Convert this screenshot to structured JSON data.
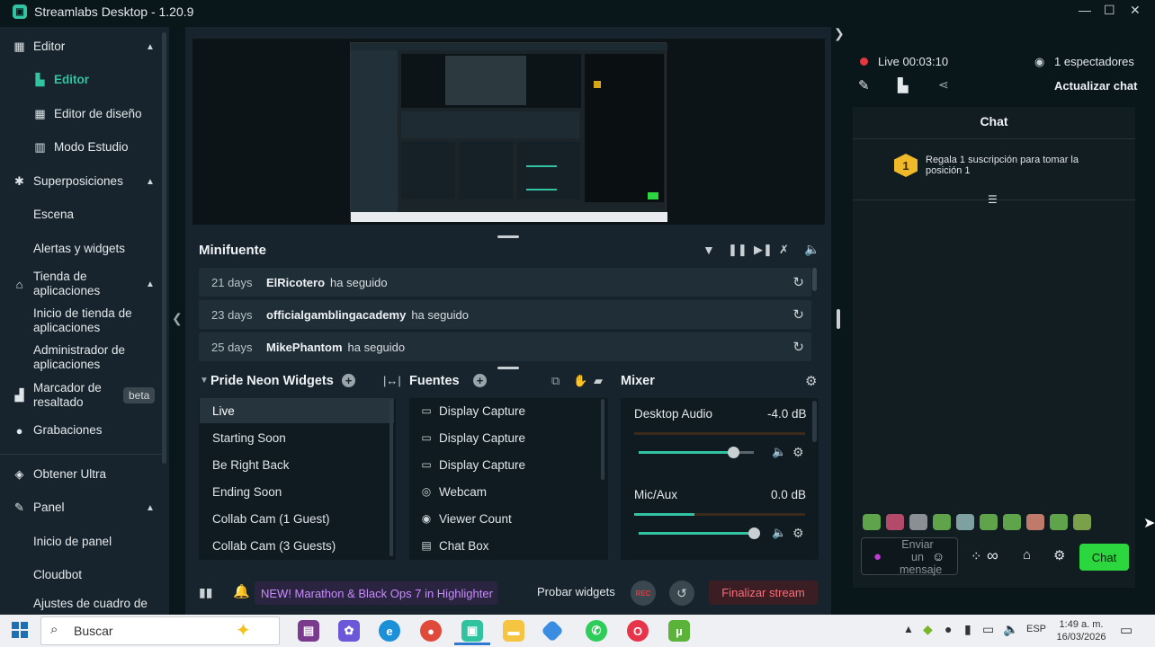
{
  "window": {
    "title": "Streamlabs Desktop - 1.20.9"
  },
  "sidebar": {
    "editor_group": "Editor",
    "editor": "Editor",
    "layout_editor": "Editor de diseño",
    "studio_mode": "Modo Estudio",
    "overlays_group": "Superposiciones",
    "scene": "Escena",
    "alerts_widgets": "Alertas y widgets",
    "app_store_group": "Tienda de aplicaciones",
    "app_store_home": "Inicio de tienda de aplicaciones",
    "app_manager": "Administrador de aplicaciones",
    "highlighter": "Marcador de resaltado",
    "highlighter_badge": "beta",
    "recordings": "Grabaciones",
    "get_ultra": "Obtener Ultra",
    "panel_group": "Panel",
    "panel_home": "Inicio de panel",
    "cloudbot": "Cloudbot",
    "dialog_settings": "Ajustes de cuadro de"
  },
  "minifeed": {
    "title": "Minifuente",
    "events": [
      {
        "days": "21 days",
        "name": "ElRicotero",
        "action": "ha seguido"
      },
      {
        "days": "23 days",
        "name": "officialgamblingacademy",
        "action": "ha seguido"
      },
      {
        "days": "25 days",
        "name": "MikePhantom",
        "action": "ha seguido"
      }
    ]
  },
  "scenes": {
    "title": "Pride Neon Widgets",
    "items": [
      "Live",
      "Starting Soon",
      "Be Right Back",
      "Ending Soon",
      "Collab Cam (1 Guest)",
      "Collab Cam (3 Guests)"
    ]
  },
  "sources": {
    "title": "Fuentes",
    "items": [
      {
        "icon": "monitor-icon",
        "label": "Display Capture"
      },
      {
        "icon": "monitor-icon",
        "label": "Display Capture"
      },
      {
        "icon": "monitor-icon",
        "label": "Display Capture"
      },
      {
        "icon": "webcam-icon",
        "label": "Webcam"
      },
      {
        "icon": "eye-icon",
        "label": "Viewer Count"
      },
      {
        "icon": "chat-icon",
        "label": "Chat Box"
      }
    ]
  },
  "mixer": {
    "title": "Mixer",
    "channels": [
      {
        "name": "Desktop Audio",
        "db": "-4.0 dB",
        "level": 0.0,
        "volume": 0.82
      },
      {
        "name": "Mic/Aux",
        "db": "0.0 dB",
        "level": 0.35,
        "volume": 1.0
      }
    ]
  },
  "bottom": {
    "banner": "NEW! Marathon & Black Ops 7 in Highlighter",
    "test_widgets": "Probar widgets",
    "rec_label": "REC",
    "end_stream": "Finalizar stream"
  },
  "live": {
    "status": "Live 00:03:10",
    "viewers": "1 espectadores",
    "refresh_chat": "Actualizar chat"
  },
  "chat": {
    "title": "Chat",
    "gift_rank": "1",
    "gift_message": "Regala 1 suscripción para tomar la posición 1",
    "input_placeholder": "Enviar un mensaje",
    "send_button": "Chat"
  },
  "taskbar": {
    "search_placeholder": "Buscar",
    "language": "ESP",
    "time": "1:49 a. m.",
    "date": "16/03/2026"
  },
  "colors": {
    "accent": "#31c3a2",
    "live_red": "#e5373f",
    "chat_green": "#2bd63e"
  }
}
